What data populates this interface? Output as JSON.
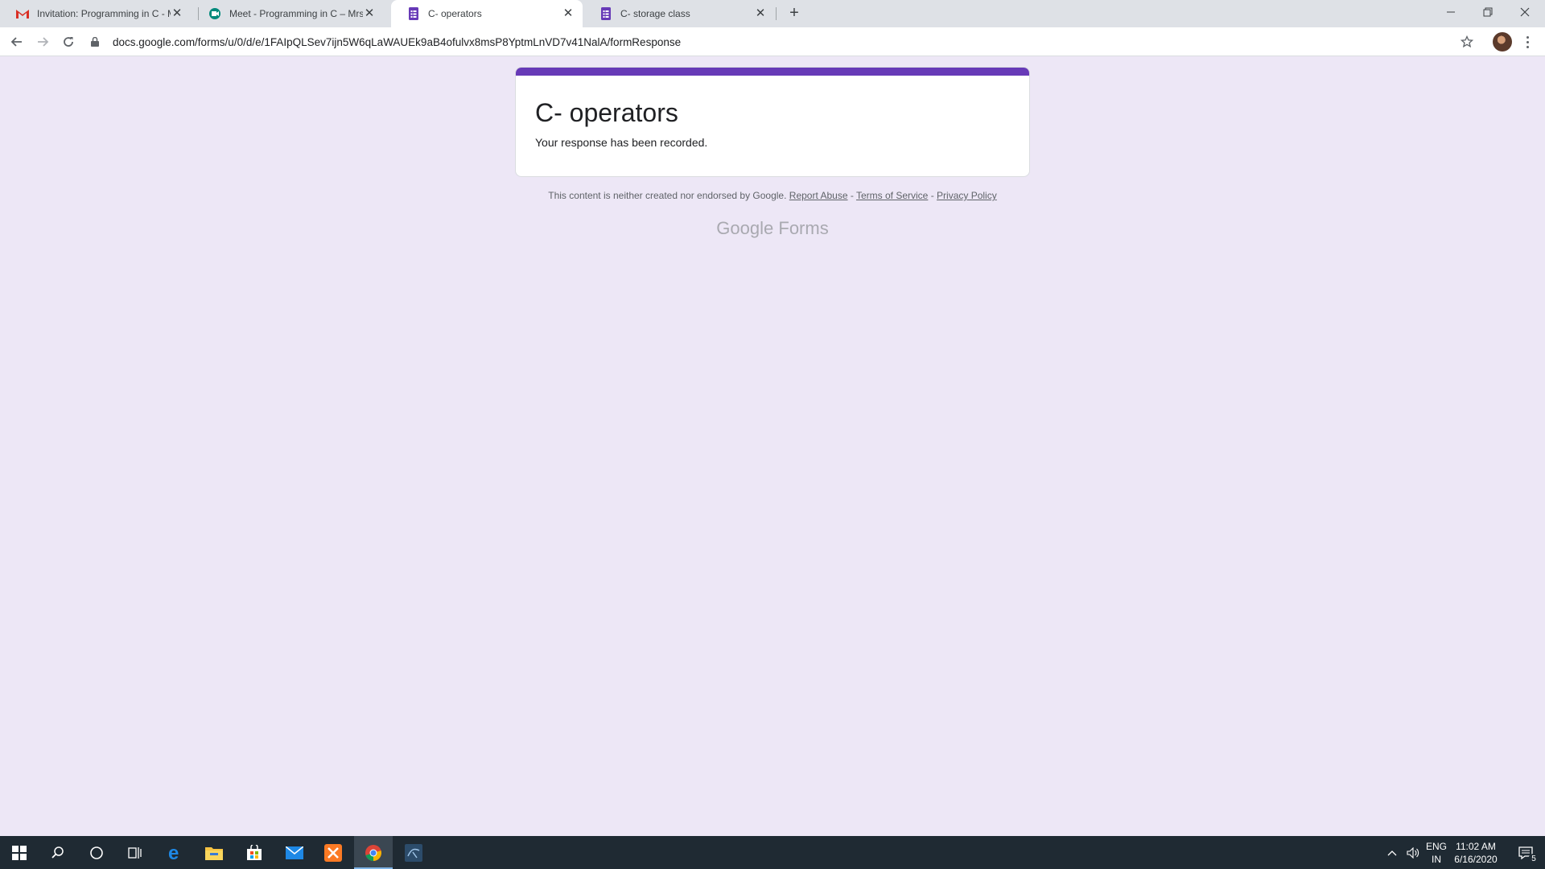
{
  "browser": {
    "tabs": [
      {
        "title": "Invitation: Programming in C - M",
        "icon": "gmail-icon",
        "active": false
      },
      {
        "title": "Meet - Programming in C – Mrs.",
        "icon": "meet-icon",
        "active": false
      },
      {
        "title": "C- operators",
        "icon": "forms-icon",
        "active": true
      },
      {
        "title": "C- storage class",
        "icon": "forms-icon",
        "active": false
      }
    ],
    "new_tab_label": "+",
    "url": "docs.google.com/forms/u/0/d/e/1FAIpQLSev7ijn5W6qLaWAUEk9aB4ofulvx8msP8YptmLnVD7v41NalA/formResponse"
  },
  "form": {
    "title": "C- operators",
    "confirmation": "Your response has been recorded.",
    "accent_color": "#673ab7",
    "background_color": "#ede7f6"
  },
  "footer": {
    "disclaimer": "This content is neither created nor endorsed by Google.",
    "report_abuse": "Report Abuse",
    "sep1": "-",
    "terms": "Terms of Service",
    "sep2": "-",
    "privacy": "Privacy Policy",
    "brand_google": "Google",
    "brand_forms": "Forms"
  },
  "taskbar": {
    "apps": [
      "start-icon",
      "search-icon",
      "cortana-icon",
      "task-view-icon",
      "edge-icon",
      "file-explorer-icon",
      "store-icon",
      "mail-icon",
      "xampp-icon",
      "chrome-icon",
      "mysql-workbench-icon"
    ],
    "language_top": "ENG",
    "language_bottom": "IN",
    "time": "11:02 AM",
    "date": "6/16/2020",
    "notifications_count": "5"
  }
}
